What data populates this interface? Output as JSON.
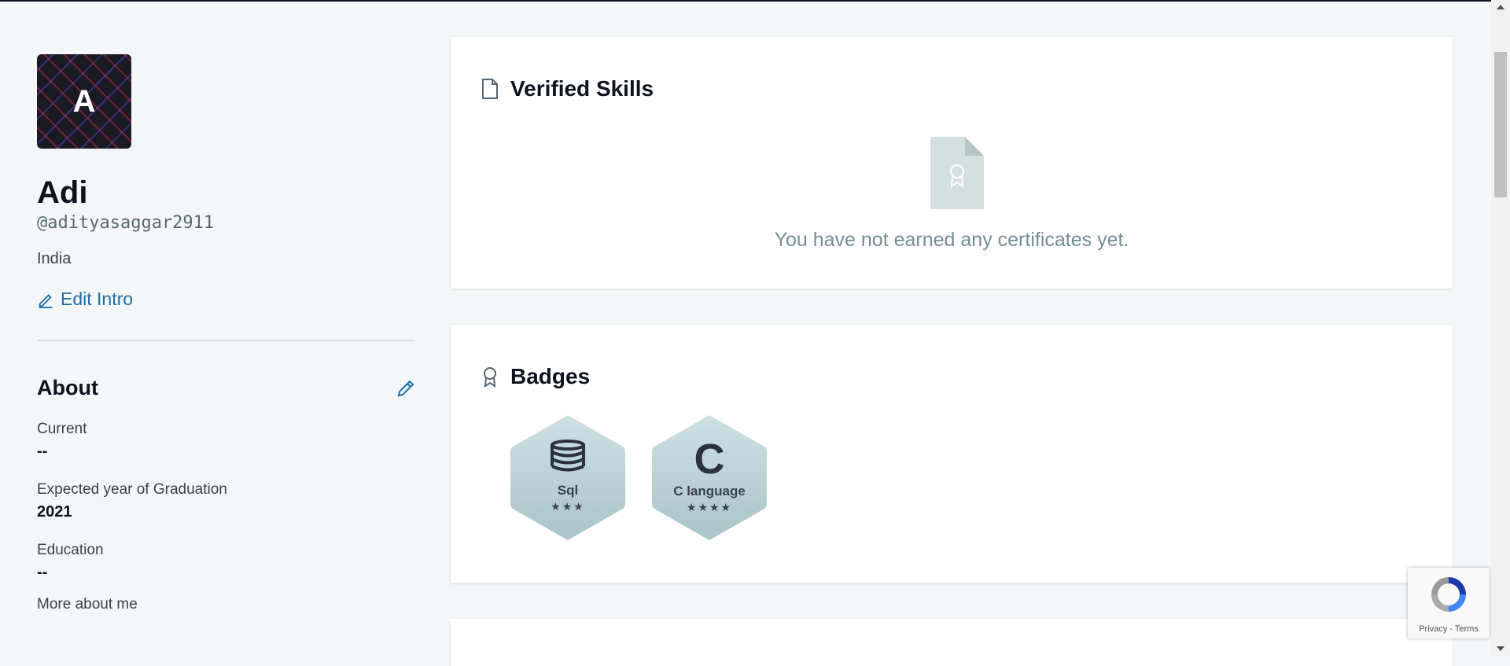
{
  "profile": {
    "avatar_letter": "A",
    "name": "Adi",
    "handle": "@adityasaggar2911",
    "country": "India",
    "edit_intro_label": "Edit Intro"
  },
  "about": {
    "title": "About",
    "fields": [
      {
        "label": "Current",
        "value": "--"
      },
      {
        "label": "Expected year of Graduation",
        "value": "2021"
      },
      {
        "label": "Education",
        "value": "--"
      },
      {
        "label": "More about me",
        "value": ""
      }
    ]
  },
  "verified_skills": {
    "title": "Verified Skills",
    "empty_message": "You have not earned any certificates yet."
  },
  "badges": {
    "title": "Badges",
    "items": [
      {
        "name": "Sql",
        "stars": "★★★",
        "icon": "database-icon"
      },
      {
        "name": "C language",
        "stars": "★★★★",
        "icon": "c-letter-icon",
        "glyph": "C"
      }
    ]
  },
  "recaptcha": {
    "privacy": "Privacy",
    "separator": " - ",
    "terms": "Terms"
  },
  "colors": {
    "accent": "#1f6ea8",
    "text": "#0e141e",
    "muted": "#738f93",
    "background": "#f3f7f7",
    "badge_fill": "#b7cfd2"
  }
}
